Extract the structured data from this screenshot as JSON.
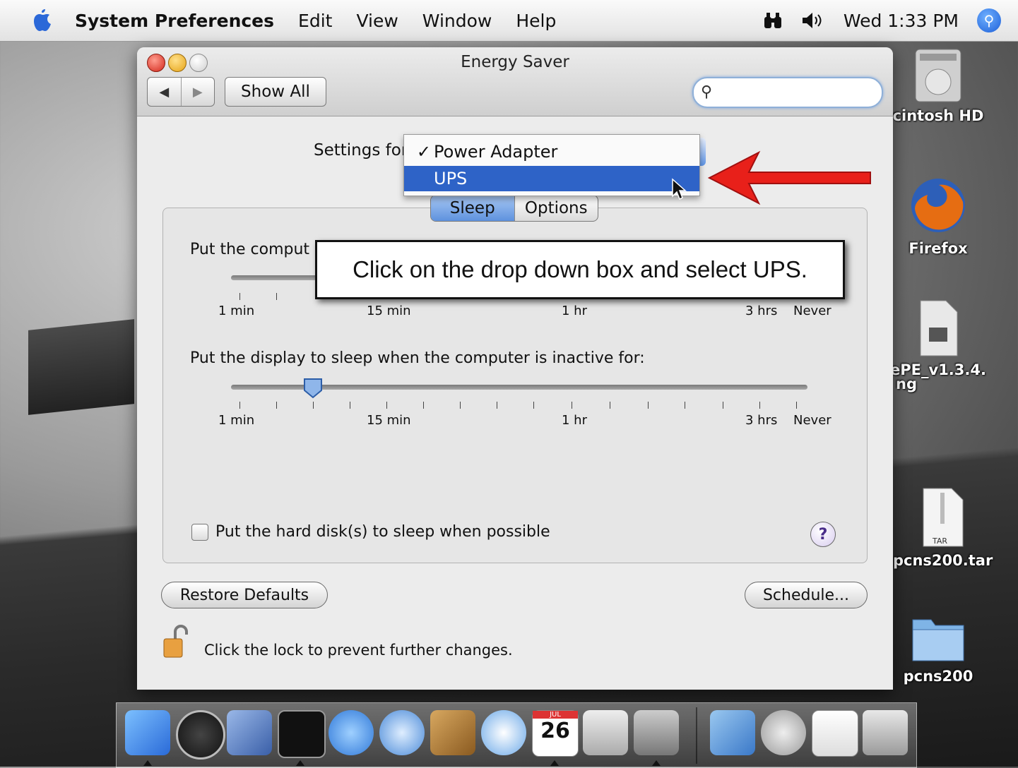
{
  "menubar": {
    "app_name": "System Preferences",
    "items": [
      "Edit",
      "View",
      "Window",
      "Help"
    ],
    "clock": "Wed 1:33 PM"
  },
  "window": {
    "title": "Energy Saver",
    "show_all": "Show All",
    "search": {
      "value": "",
      "placeholder": ""
    },
    "settings_for_label": "Settings for",
    "dropdown": {
      "options": [
        "Power Adapter",
        "UPS"
      ],
      "checked": "Power Adapter",
      "highlighted": "UPS",
      "check_glyph": "✓"
    },
    "tabs": [
      "Sleep",
      "Options"
    ],
    "active_tab": "Sleep",
    "computer_sleep_label": "Put the comput",
    "display_sleep_label": "Put the display to sleep when the computer is inactive for:",
    "display_sleep_value": "5 min",
    "tick_labels": [
      "1 min",
      "15 min",
      "1 hr",
      "3 hrs",
      "Never"
    ],
    "hard_disk_label": "Put the hard disk(s) to sleep when possible",
    "hard_disk_checked": false,
    "help": "?",
    "restore_defaults": "Restore Defaults",
    "schedule": "Schedule...",
    "lock_text": "Click the lock to prevent further changes."
  },
  "callout": {
    "text": "Click on the drop down box and select UPS."
  },
  "desktop": {
    "icons": [
      {
        "label": "cintosh HD"
      },
      {
        "label": "Firefox"
      },
      {
        "label": "ePE_v1.3.4."
      },
      {
        "label": "ng"
      },
      {
        "label": "pcns200.tar"
      },
      {
        "label": "pcns200"
      }
    ],
    "tar_badge": "TAR"
  },
  "dock": {
    "apps": [
      "finder",
      "dashboard",
      "mail",
      "terminal",
      "ichat",
      "safari",
      "address-book",
      "itunes",
      "ical",
      "preview",
      "system-preferences",
      "applications",
      "mail-folder",
      "documents",
      "trash"
    ],
    "ical_day": "26",
    "ical_month": "JUL"
  },
  "colors": {
    "highlight": "#2e63c7",
    "arrow": "#e8201a",
    "tab_active": "#5e92de"
  }
}
